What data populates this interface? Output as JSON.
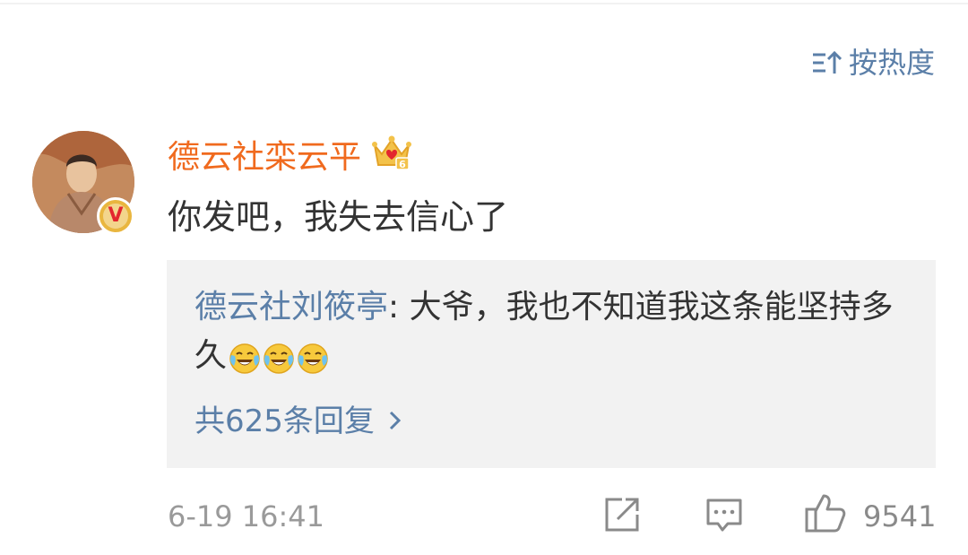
{
  "sort": {
    "label": "按热度",
    "icon": "sort-icon"
  },
  "comment": {
    "username": "德云社栾云平",
    "badge_icon": "crown-badge-icon",
    "badge_level": "6",
    "verified_icon": "verified-v-icon",
    "verified_letter": "V",
    "text": "你发吧，我失去信心了",
    "timestamp": "6-19 16:41",
    "likes": "9541"
  },
  "reply": {
    "author": "德云社刘筱亭",
    "separator": ": ",
    "text": "大爷，我也不知道我这条能坚持多久",
    "emojis": [
      "laugh-cry-emoji",
      "laugh-cry-emoji",
      "laugh-cry-emoji"
    ],
    "count_label": "共625条回复",
    "chevron": "›"
  },
  "colors": {
    "link": "#5b7fa8",
    "username": "#f06a1e",
    "text": "#333333",
    "meta": "#9a9a9a",
    "reply_bg": "#f2f2f2"
  },
  "actions": {
    "share_icon": "share-icon",
    "comment_icon": "comment-icon",
    "like_icon": "thumbs-up-icon"
  }
}
